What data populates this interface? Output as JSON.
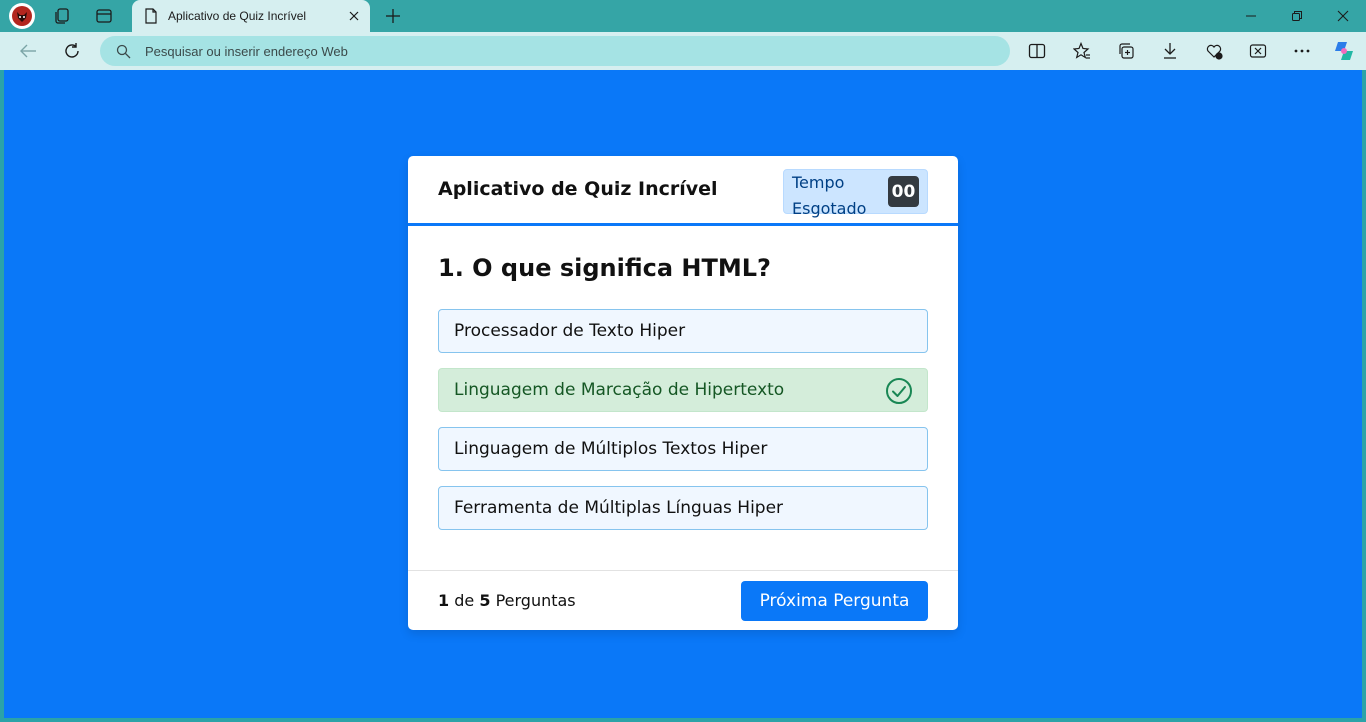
{
  "browser": {
    "tab_title": "Aplicativo de Quiz Incrível",
    "address_placeholder": "Pesquisar ou inserir endereço Web"
  },
  "quiz": {
    "app_title": "Aplicativo de Quiz Incrível",
    "timer_label": "Tempo Esgotado",
    "timer_seconds": "00",
    "question": "1. O que significa HTML?",
    "options": [
      {
        "text": "Processador de Texto Hiper",
        "state": "normal"
      },
      {
        "text": "Linguagem de Marcação de Hipertexto",
        "state": "correct"
      },
      {
        "text": "Linguagem de Múltiplos Textos Hiper",
        "state": "normal"
      },
      {
        "text": "Ferramenta de Múltiplas Línguas Hiper",
        "state": "normal"
      }
    ],
    "progress": {
      "current": "1",
      "of": "de",
      "total": "5",
      "label": "Perguntas"
    },
    "next_button": "Próxima Pergunta"
  },
  "colors": {
    "page_bg": "#0a78f8",
    "correct_bg": "#d4edda",
    "correct_text": "#155724",
    "timer_bg": "#cce5ff"
  }
}
